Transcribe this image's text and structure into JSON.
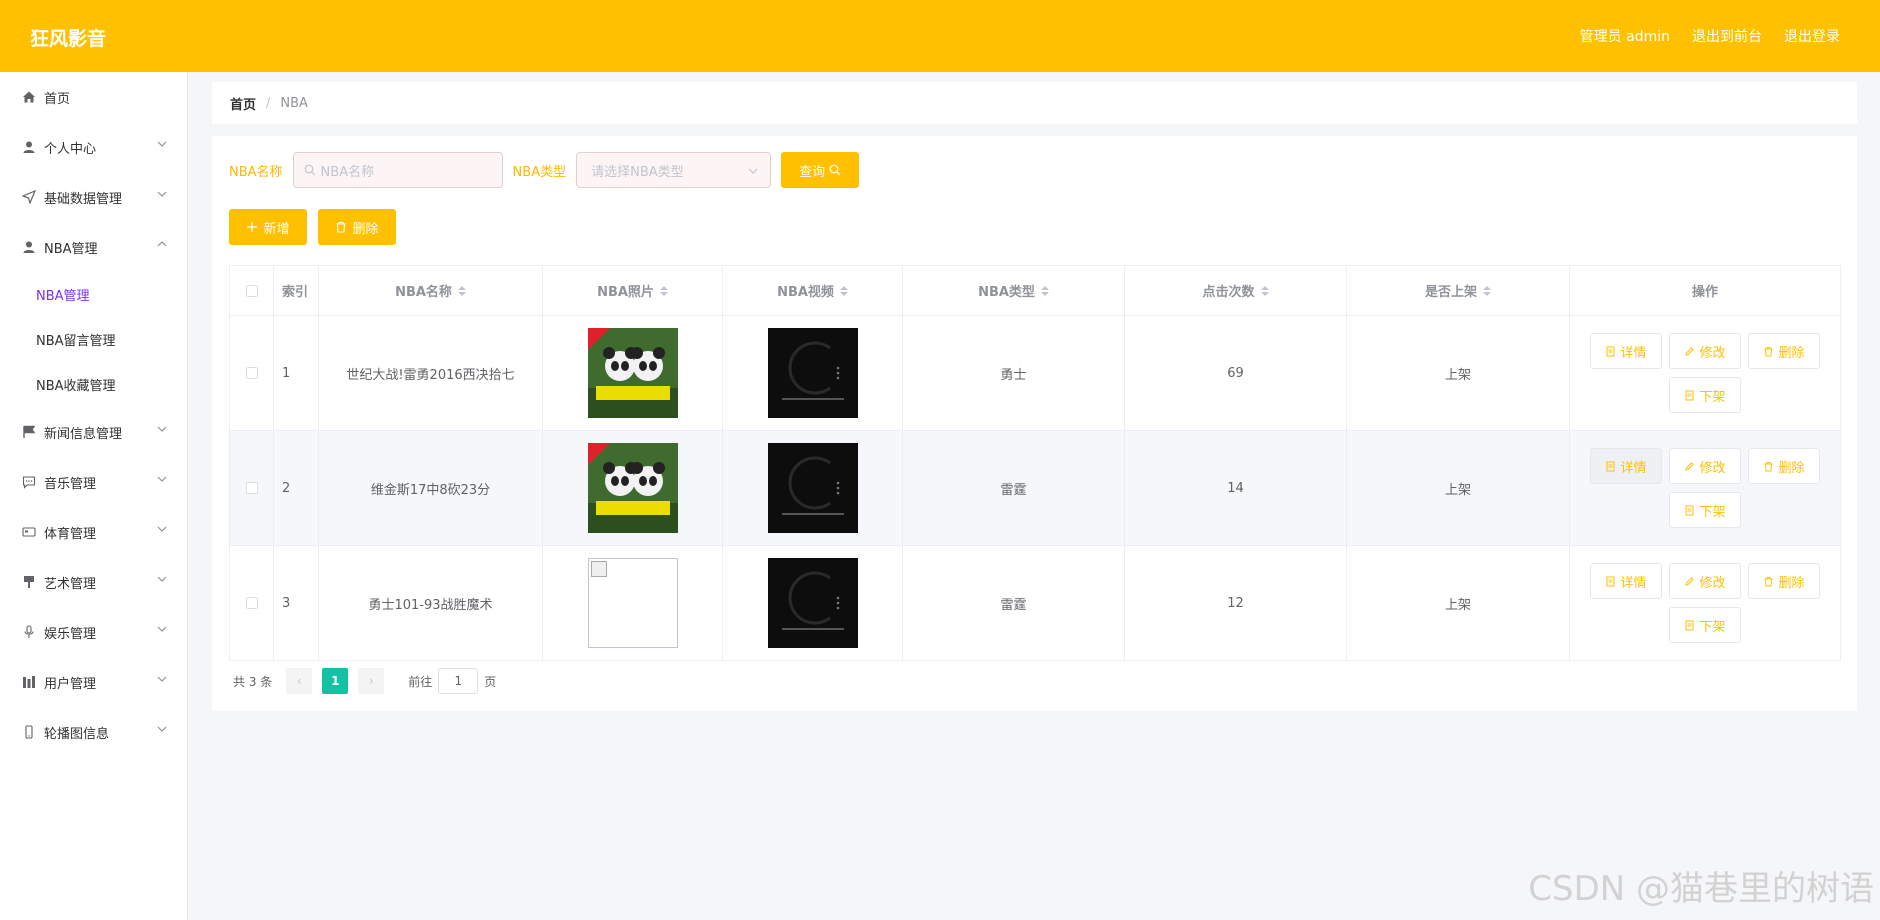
{
  "header": {
    "brand": "狂风影音",
    "admin": "管理员 admin",
    "to_front": "退出到前台",
    "logout": "退出登录"
  },
  "sidebar": {
    "items": [
      {
        "label": "首页",
        "icon": "home-icon"
      },
      {
        "label": "个人中心",
        "icon": "user-icon"
      },
      {
        "label": "基础数据管理",
        "icon": "send-icon"
      },
      {
        "label": "NBA管理",
        "icon": "user-icon"
      },
      {
        "label": "新闻信息管理",
        "icon": "flag-icon"
      },
      {
        "label": "音乐管理",
        "icon": "chat-icon"
      },
      {
        "label": "体育管理",
        "icon": "card-icon"
      },
      {
        "label": "艺术管理",
        "icon": "brush-icon"
      },
      {
        "label": "娱乐管理",
        "icon": "mic-icon"
      },
      {
        "label": "用户管理",
        "icon": "chart-icon"
      },
      {
        "label": "轮播图信息",
        "icon": "phone-icon"
      }
    ],
    "submenu": [
      "NBA管理",
      "NBA留言管理",
      "NBA收藏管理"
    ]
  },
  "breadcrumb": {
    "home": "首页",
    "sep": "/",
    "current": "NBA"
  },
  "search": {
    "name_label": "NBA名称",
    "name_placeholder": "NBA名称",
    "type_label": "NBA类型",
    "type_placeholder": "请选择NBA类型",
    "query_button": "查询"
  },
  "actions": {
    "add": "新增",
    "delete": "删除"
  },
  "table": {
    "headers": [
      "索引",
      "NBA名称",
      "NBA照片",
      "NBA视频",
      "NBA类型",
      "点击次数",
      "是否上架",
      "操作"
    ],
    "rows": [
      {
        "index": "1",
        "name": "世纪大战!雷勇2016西决拾七",
        "photo": "panda",
        "type": "勇士",
        "clicks": "69",
        "status": "上架"
      },
      {
        "index": "2",
        "name": "维金斯17中8砍23分",
        "photo": "panda",
        "type": "雷霆",
        "clicks": "14",
        "status": "上架"
      },
      {
        "index": "3",
        "name": "勇士101-93战胜魔术",
        "photo": "broken",
        "type": "雷霆",
        "clicks": "12",
        "status": "上架"
      }
    ],
    "op_labels": {
      "detail": "详情",
      "edit": "修改",
      "delete": "删除",
      "offshelf": "下架"
    }
  },
  "pager": {
    "total": "共 3 条",
    "current": "1",
    "goto": "前往",
    "page_value": "1",
    "page_unit": "页"
  },
  "watermark": "CSDN @猫巷里的树语",
  "colors": {
    "primary": "#ffc000",
    "active_menu": "#7b2ff7",
    "pager_active": "#13c2a3"
  }
}
